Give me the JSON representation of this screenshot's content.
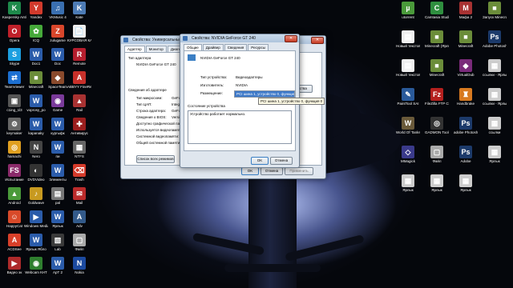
{
  "desktop_left": [
    {
      "label": "Kaspersky Antivirus",
      "color": "#1e8a4b",
      "glyph": "K"
    },
    {
      "label": "Yandex",
      "color": "#d23a2c",
      "glyph": "Y"
    },
    {
      "label": "VKMusic 4",
      "color": "#3a6fb0",
      "glyph": "♫"
    },
    {
      "label": "Kate",
      "color": "#4d7bb5",
      "glyph": "K"
    },
    {
      "label": "Opera",
      "color": "#c0202a",
      "glyph": "O"
    },
    {
      "label": "ICQ",
      "color": "#46a93a",
      "glyph": "✿"
    },
    {
      "label": "zulugame",
      "color": "#d9462b",
      "glyph": "Z"
    },
    {
      "label": "КУРСОВАЯ КАРПОВА",
      "color": "#eeeeee",
      "glyph": "📄"
    },
    {
      "label": "Skype",
      "color": "#1d9fe0",
      "glyph": "S"
    },
    {
      "label": "Doc1",
      "color": "#2b5caa",
      "glyph": "W"
    },
    {
      "label": "Doc",
      "color": "#2b5caa",
      "glyph": "W"
    },
    {
      "label": "Remote",
      "color": "#b51e2e",
      "glyph": "R"
    },
    {
      "label": "TeamViewer",
      "color": "#1c6fd1",
      "glyph": "⇄"
    },
    {
      "label": "Minecraft",
      "color": "#6b8d3a",
      "glyph": "■"
    },
    {
      "label": "SpaceTeam",
      "color": "#8a4a2c",
      "glyph": "◆"
    },
    {
      "label": "ABBYY FineReader",
      "color": "#c8302a",
      "glyph": "A"
    },
    {
      "label": "c1ing_1l3",
      "color": "#555555",
      "glyph": "▣"
    },
    {
      "label": "voprosy_po",
      "color": "#2b5caa",
      "glyph": "W"
    },
    {
      "label": "Game",
      "color": "#7a3a9a",
      "glyph": "◉"
    },
    {
      "label": "Rail",
      "color": "#a83232",
      "glyph": "▲"
    },
    {
      "label": "keymaker",
      "color": "#666666",
      "glyph": "⚙"
    },
    {
      "label": "kapanaky",
      "color": "#2b5caa",
      "glyph": "W"
    },
    {
      "label": "кургыфк",
      "color": "#2b5caa",
      "glyph": "W"
    },
    {
      "label": "Антивирус",
      "color": "#9b1e1e",
      "glyph": "✚"
    },
    {
      "label": "hamachi",
      "color": "#e0a020",
      "glyph": "◎"
    },
    {
      "label": "Nero",
      "color": "#444444",
      "glyph": "N"
    },
    {
      "label": "пи",
      "color": "#2b5caa",
      "glyph": "W"
    },
    {
      "label": "NTFS",
      "color": "#666666",
      "glyph": "▦"
    },
    {
      "label": "Испытание",
      "color": "#8a2a6a",
      "glyph": "FS"
    },
    {
      "label": "DVDVideo",
      "color": "#333333",
      "glyph": "◐"
    },
    {
      "label": "Элементы",
      "color": "#2b5caa",
      "glyph": "W"
    },
    {
      "label": "Trash",
      "color": "#d43a2a",
      "glyph": "⌫"
    },
    {
      "label": "Android",
      "color": "#4a9a3a",
      "glyph": "▲"
    },
    {
      "label": "Goldwave",
      "color": "#c89a20",
      "glyph": "♪"
    },
    {
      "label": "pal",
      "color": "#777777",
      "glyph": "▤"
    },
    {
      "label": "Mail",
      "color": "#bb2b2b",
      "glyph": "✉"
    },
    {
      "label": "HappyCat",
      "color": "#d84a2a",
      "glyph": "☺"
    },
    {
      "label": "Windows Media",
      "color": "#2b5caa",
      "glyph": "▶"
    },
    {
      "label": "Ярлык",
      "color": "#2b5caa",
      "glyph": "W"
    },
    {
      "label": "Adv",
      "color": "#335a8a",
      "glyph": "A"
    },
    {
      "label": "ACDSee",
      "color": "#d8402a",
      "glyph": "A"
    },
    {
      "label": "Ярлык Ябло",
      "color": "#2b5caa",
      "glyph": "W"
    },
    {
      "label": "Lab",
      "color": "#3a3a3a",
      "glyph": "▧"
    },
    {
      "label": "Файл",
      "color": "#aaaaaa",
      "glyph": "▢"
    },
    {
      "label": "Видео эк",
      "color": "#ae2a2a",
      "glyph": "▶"
    },
    {
      "label": "Webcam КНТ",
      "color": "#2f7f2f",
      "glyph": "◉"
    },
    {
      "label": "АрТ 2",
      "color": "#2b5caa",
      "glyph": "W"
    },
    {
      "label": "Nokia",
      "color": "#1c4aa0",
      "glyph": "N"
    }
  ],
  "desktop_right": [
    {
      "label": "utorrent",
      "color": "#4a9a3a",
      "glyph": "µ"
    },
    {
      "label": "Camtasia Studio 7",
      "color": "#2f8f3f",
      "glyph": "C"
    },
    {
      "label": "Мафа 2",
      "color": "#a83232",
      "glyph": "M"
    },
    {
      "label": "Запуск Minecraft",
      "color": "#6b8d3a",
      "glyph": "■"
    },
    {
      "label": "Новый текстовый",
      "color": "#f0f0f0",
      "glyph": "▤"
    },
    {
      "label": "Minecraft (Ярлык)",
      "color": "#6b8d3a",
      "glyph": "■"
    },
    {
      "label": "Minecraft",
      "color": "#6b8d3a",
      "glyph": "■"
    },
    {
      "label": "Adobe Photosh",
      "color": "#1c3a6a",
      "glyph": "Ps"
    },
    {
      "label": "Новый текстовый",
      "color": "#f0f0f0",
      "glyph": "▤"
    },
    {
      "label": "Minecraft",
      "color": "#6b8d3a",
      "glyph": "■"
    },
    {
      "label": "VirtualDub",
      "color": "#7a2a7a",
      "glyph": "◆"
    },
    {
      "label": "ссылки - Ярлык",
      "color": "#cccccc",
      "glyph": "▦"
    },
    {
      "label": "PaintTool SAI",
      "color": "#2a5a9a",
      "glyph": "✎"
    },
    {
      "label": "FileZilla FTP Client",
      "color": "#b5201e",
      "glyph": "Fz"
    },
    {
      "label": "Handbrake",
      "color": "#d87a20",
      "glyph": "♜"
    },
    {
      "label": "ссылки - Ярлык 5",
      "color": "#cccccc",
      "glyph": "▦"
    },
    {
      "label": "World Of Tanks",
      "color": "#6a5a3a",
      "glyph": "W"
    },
    {
      "label": "GADMON Tools Lite",
      "color": "#333333",
      "glyph": "◎"
    },
    {
      "label": "adobe Photosh",
      "color": "#1c3a6a",
      "glyph": "Ps"
    },
    {
      "label": "ссылки",
      "color": "#cccccc",
      "glyph": "▦"
    },
    {
      "label": "MMagick",
      "color": "#3a3a8a",
      "glyph": "◇"
    },
    {
      "label": "Файл",
      "color": "#aaaaaa",
      "glyph": "▢"
    },
    {
      "label": "Adobe",
      "color": "#1c3a6a",
      "glyph": "Ps"
    },
    {
      "label": "Ярлык",
      "color": "#cccccc",
      "glyph": "▦"
    },
    {
      "label": "Ярлык",
      "color": "#cccccc",
      "glyph": "▦"
    },
    {
      "label": "Ярлык",
      "color": "#cccccc",
      "glyph": "▦"
    },
    {
      "label": "Ярлык",
      "color": "#cccccc",
      "glyph": "▦"
    }
  ],
  "back_window": {
    "title": "Свойства: Универсальный монитор PnP",
    "tabs": [
      "Адаптер",
      "Монитор",
      "Диагностика"
    ],
    "adapter_type_label": "Тип адаптера",
    "adapter_name": "NVIDIA GeForce GT 240",
    "properties_button": "Свойства",
    "adapter_info_label": "Сведения об адаптере",
    "rows": [
      {
        "k": "Тип микросхем:",
        "v": "GeForce GT 240"
      },
      {
        "k": "Тип ЦАП:",
        "v": "Integrated RAMDAC"
      },
      {
        "k": "Строка адаптера:",
        "v": "GeForce GT 240"
      },
      {
        "k": "Сведения о BIOS:",
        "v": "Version 70.15.1E.00.00"
      },
      {
        "k": "Доступно графической памяти:",
        "v": ""
      },
      {
        "k": "Используется видеопамяти:",
        "v": ""
      },
      {
        "k": "Системной видеопамяти:",
        "v": ""
      },
      {
        "k": "Общей системной памяти:",
        "v": ""
      }
    ],
    "list_modes_button": "Список всех режимов",
    "ok_button": "OK",
    "cancel_button": "Отмена",
    "apply_button": "Применить"
  },
  "front_window": {
    "title": "Свойства: NVIDIA GeForce GT 240",
    "tabs": [
      "Общие",
      "Драйвер",
      "Сведения",
      "Ресурсы"
    ],
    "device_name": "NVIDIA GeForce GT 240",
    "device_type_label": "Тип устройства:",
    "device_type_value": "Видеоадаптеры",
    "manufacturer_label": "Изготовитель:",
    "manufacturer_value": "NVIDIA",
    "location_label": "Размещение:",
    "location_value": "PCI шина 1, устройство 0, функция 0",
    "tooltip": "PCI шина 1, устройство 0, функция 0",
    "status_label": "Состояние устройства",
    "status_text": "Устройство работает нормально.",
    "ok_button": "OK",
    "cancel_button": "Отмена"
  }
}
